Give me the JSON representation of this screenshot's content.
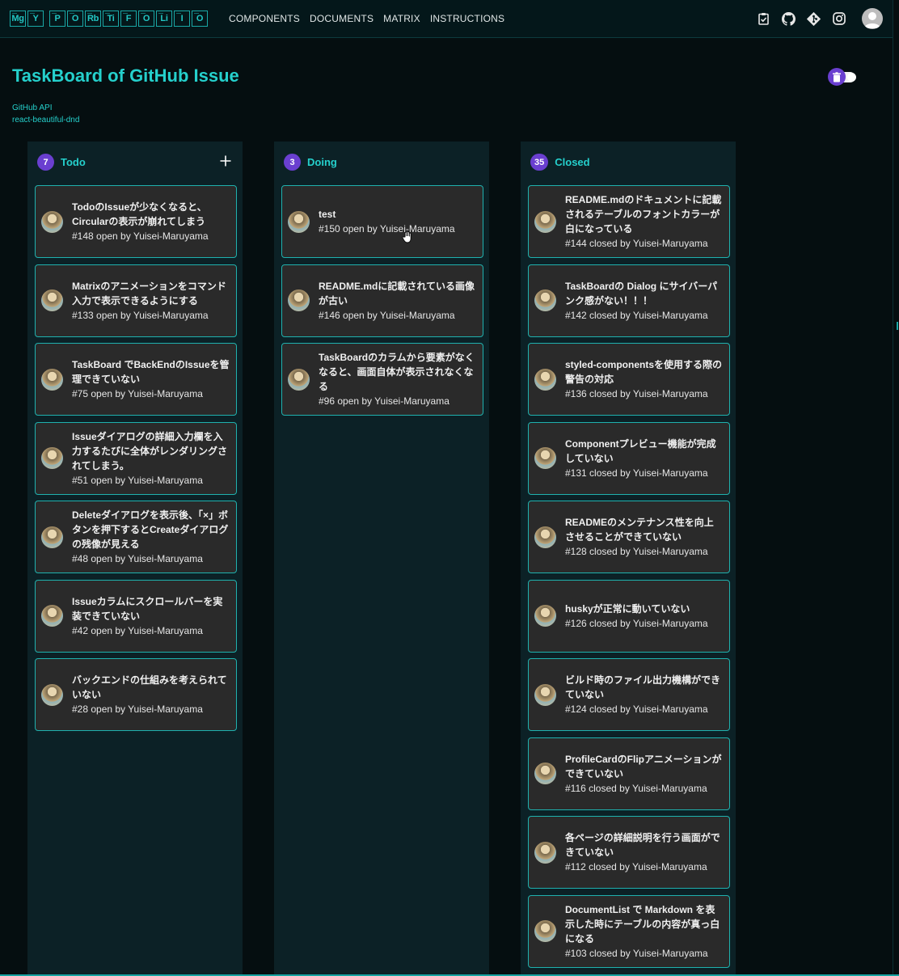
{
  "logo": {
    "groups": [
      [
        "Mg",
        "Y"
      ],
      [
        "P",
        "O",
        "Rb",
        "Ti",
        "F",
        "O",
        "Li",
        "I",
        "O"
      ]
    ]
  },
  "nav": {
    "components": "COMPONENTS",
    "documents": "DOCUMENTS",
    "matrix": "MATRIX",
    "instructions": "INSTRUCTIONS"
  },
  "header_icons": [
    "clipboard-check-icon",
    "github-icon",
    "git-icon",
    "instagram-icon",
    "account-avatar-icon"
  ],
  "page": {
    "title": "TaskBoard of GitHub Issue",
    "links": [
      "GitHub API",
      "react-beautiful-dnd"
    ],
    "toggle_icon": "trash-icon"
  },
  "colors": {
    "accent": "#25d0cc",
    "badge": "#6a3fd0",
    "card_bg": "#2a2a2a",
    "column_bg": "#0c2126"
  },
  "columns": [
    {
      "count": "7",
      "title": "Todo",
      "has_add": true,
      "cards": [
        {
          "title": "TodoのIssueが少なくなると、Circularの表示が崩れてしまう",
          "meta": "#148 open by Yuisei-Maruyama"
        },
        {
          "title": "Matrixのアニメーションをコマンド入力で表示できるようにする",
          "meta": "#133 open by Yuisei-Maruyama"
        },
        {
          "title": "TaskBoard でBackEndのIssueを管理できていない",
          "meta": "#75 open by Yuisei-Maruyama"
        },
        {
          "title": "Issueダイアログの詳細入力欄を入力するたびに全体がレンダリングされてしまう。",
          "meta": "#51 open by Yuisei-Maruyama"
        },
        {
          "title": "Deleteダイアログを表示後、「×」ボタンを押下するとCreateダイアログの残像が見える",
          "meta": "#48 open by Yuisei-Maruyama"
        },
        {
          "title": "Issueカラムにスクロールバーを実装できていない",
          "meta": "#42 open by Yuisei-Maruyama"
        },
        {
          "title": "バックエンドの仕組みを考えられていない",
          "meta": "#28 open by Yuisei-Maruyama"
        }
      ]
    },
    {
      "count": "3",
      "title": "Doing",
      "has_add": false,
      "cards": [
        {
          "title": "test",
          "meta": "#150 open by Yuisei-Maruyama"
        },
        {
          "title": "README.mdに記載されている画像が古い",
          "meta": "#146 open by Yuisei-Maruyama"
        },
        {
          "title": "TaskBoardのカラムから要素がなくなると、画面自体が表示されなくなる",
          "meta": "#96 open by Yuisei-Maruyama"
        }
      ]
    },
    {
      "count": "35",
      "title": "Closed",
      "has_add": false,
      "cards": [
        {
          "title": "README.mdのドキュメントに記載されるテーブルのフォントカラーが白になっている",
          "meta": "#144 closed by Yuisei-Maruyama"
        },
        {
          "title": "TaskBoardの Dialog にサイバーパンク感がない！！！",
          "meta": "#142 closed by Yuisei-Maruyama"
        },
        {
          "title": "styled-componentsを使用する際の警告の対応",
          "meta": "#136 closed by Yuisei-Maruyama"
        },
        {
          "title": "Componentプレビュー機能が完成していない",
          "meta": "#131 closed by Yuisei-Maruyama"
        },
        {
          "title": "READMEのメンテナンス性を向上させることができていない",
          "meta": "#128 closed by Yuisei-Maruyama"
        },
        {
          "title": "huskyが正常に動いていない",
          "meta": "#126 closed by Yuisei-Maruyama"
        },
        {
          "title": "ビルド時のファイル出力機構ができていない",
          "meta": "#124 closed by Yuisei-Maruyama"
        },
        {
          "title": "ProfileCardのFlipアニメーションができていない",
          "meta": "#116 closed by Yuisei-Maruyama"
        },
        {
          "title": "各ページの詳細説明を行う画面ができていない",
          "meta": "#112 closed by Yuisei-Maruyama"
        },
        {
          "title": "DocumentList で Markdown を表示した時にテーブルの内容が真っ白になる",
          "meta": "#103 closed by Yuisei-Maruyama"
        }
      ]
    }
  ]
}
